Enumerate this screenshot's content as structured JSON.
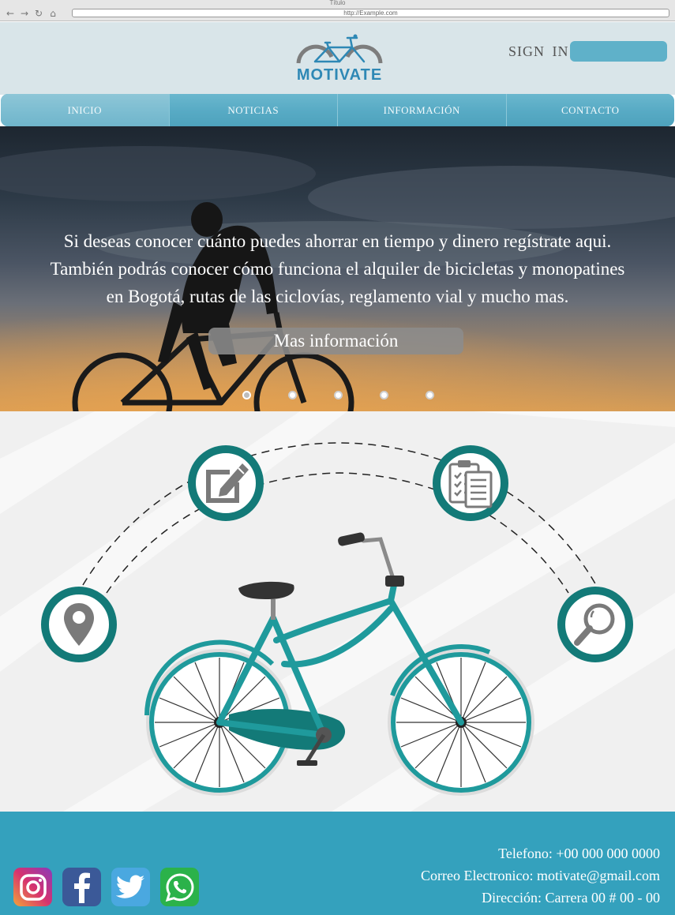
{
  "browser": {
    "title": "Título",
    "url": "http://Example.com",
    "nav_icons": [
      "back-arrow-icon",
      "forward-arrow-icon",
      "reload-icon",
      "home-icon"
    ]
  },
  "header": {
    "logo_text": "MOTIVATE",
    "sign_in_label": "SIGN  IN",
    "sign_in_placeholder": "",
    "background_color": "#d9e5e9",
    "accent_color": "#2e88b5"
  },
  "nav": {
    "items": [
      {
        "label": "INICIO",
        "active": true
      },
      {
        "label": "NOTICIAS",
        "active": false
      },
      {
        "label": "INFORMACIÓN",
        "active": false
      },
      {
        "label": "CONTACTO",
        "active": false
      }
    ],
    "color": "#57aac4"
  },
  "hero": {
    "lines": [
      "Si deseas conocer cuánto puedes ahorrar en tiempo y dinero regístrate aqui.",
      "También podrás conocer cómo funciona el alquiler de bicicletas y monopatines",
      "en Bogotá, rutas de las ciclovías, reglamento vial y mucho mas."
    ],
    "button_label": "Mas información",
    "carousel": {
      "slides": 5,
      "active_index": 0
    }
  },
  "features": {
    "ring_color": "#137a78",
    "bike_color": "#1e9a9c",
    "icons": [
      "location-pin-icon",
      "edit-pencil-icon",
      "checklist-clipboard-icon",
      "search-magnifier-icon"
    ]
  },
  "footer": {
    "phone": "Telefono: +00 000 000 0000",
    "email": "Correo Electronico: motivate@gmail.com",
    "address": "Dirección: Carrera 00 # 00 - 00",
    "background_color": "#34a1bd",
    "social": [
      "instagram-icon",
      "facebook-icon",
      "twitter-icon",
      "whatsapp-icon"
    ]
  }
}
